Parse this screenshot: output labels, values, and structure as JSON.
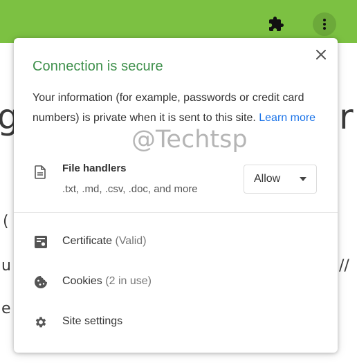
{
  "toolbar": {
    "color": "#7cc142",
    "icons": [
      "puzzle-icon",
      "vertical-dots-icon"
    ]
  },
  "popup": {
    "title": "Connection is secure",
    "title_color": "#3d8f4a",
    "description": "Your information (for example, passwords or credit card numbers) is private when it is sent to this site.",
    "learn_more": "Learn more",
    "link_color": "#1a73e8",
    "permission": {
      "icon": "file-icon",
      "name": "File handlers",
      "detail": ".txt, .md, .csv, .doc, and more",
      "value": "Allow"
    },
    "rows": [
      {
        "icon": "certificate-icon",
        "label": "Certificate",
        "sub": "(Valid)"
      },
      {
        "icon": "cookie-icon",
        "label": "Cookies",
        "sub": "(2 in use)"
      },
      {
        "icon": "gear-icon",
        "label": "Site settings",
        "sub": ""
      }
    ]
  },
  "watermark": "@Techtsp"
}
